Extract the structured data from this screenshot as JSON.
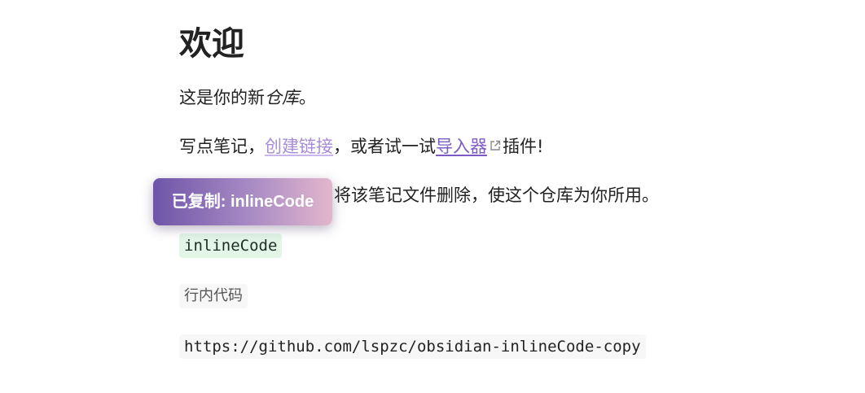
{
  "note": {
    "title": "欢迎",
    "p1_prefix": "这是你的新",
    "p1_italic": "仓库",
    "p1_suffix": "。",
    "p2_prefix": "写点笔记，",
    "p2_internal_link": "创建链接",
    "p2_middle": "，或者试一试",
    "p2_external_link": "导入器",
    "p2_suffix": "插件!",
    "p3_text": "将该笔记文件删除，使这个仓库为你所用。",
    "inline_code_1": "inlineCode",
    "inline_code_2": "行内代码",
    "inline_code_3": "https://github.com/lspzc/obsidian-inlineCode-copy"
  },
  "toast": {
    "message": "已复制: inlineCode"
  },
  "icons": {
    "external_link": "external-link-icon"
  },
  "colors": {
    "link_internal": "#a68bd6",
    "link_external": "#7c5cc4",
    "code_highlight": "#e2f5e6",
    "code_background": "#f7f7f7",
    "toast_gradient_start": "#6e55a8",
    "toast_gradient_end": "#e3b6cc"
  }
}
